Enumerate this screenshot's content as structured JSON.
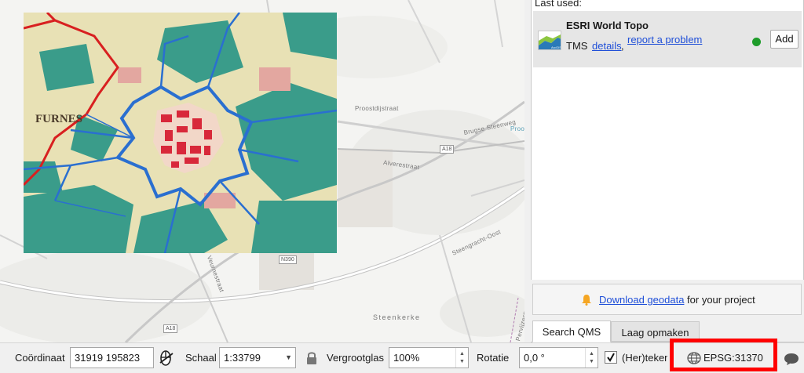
{
  "dock": {
    "last_used_label": "Last used:",
    "service": {
      "title": "ESRI World Topo",
      "type": "TMS",
      "details_link": "details",
      "comma": ",",
      "report_link": "report a problem",
      "add_button": "Add",
      "status_color": "#1e9c2a"
    },
    "download": {
      "link": "Download geodata",
      "suffix": " for your project"
    },
    "tabs": [
      {
        "label": "Search QMS",
        "active": true
      },
      {
        "label": "Laag opmaken",
        "active": false
      }
    ]
  },
  "statusbar": {
    "coordinate_label": "Coördinaat",
    "coordinate_value": "31919  195823",
    "scale_label": "Schaal",
    "scale_value": "1:33799",
    "magnifier_label": "Vergrootglas",
    "magnifier_value": "100%",
    "rotation_label": "Rotatie",
    "rotation_value": "0,0 °",
    "render_checked": true,
    "render_label": "(Her)teken",
    "crs_value": "EPSG:31370"
  },
  "map": {
    "labels": {
      "place_furnes": "FURNES",
      "place_steenkerke": "Steenkerke",
      "street_brugse": "Brugse Steenweg",
      "street_alvere": "Alverestraat",
      "street_proost": "Proostdijstraat",
      "street_steengracht": "Steengracht-Oost",
      "street_veurne": "Veurnestraat",
      "road_a18": "A18",
      "road_n390": "N390",
      "road_a18b": "A18",
      "place_proo": "Proo",
      "street_pervijze": "Pervijzestraat"
    }
  },
  "colors": {
    "highlight": "#ff0000",
    "link": "#1f4fd8"
  }
}
